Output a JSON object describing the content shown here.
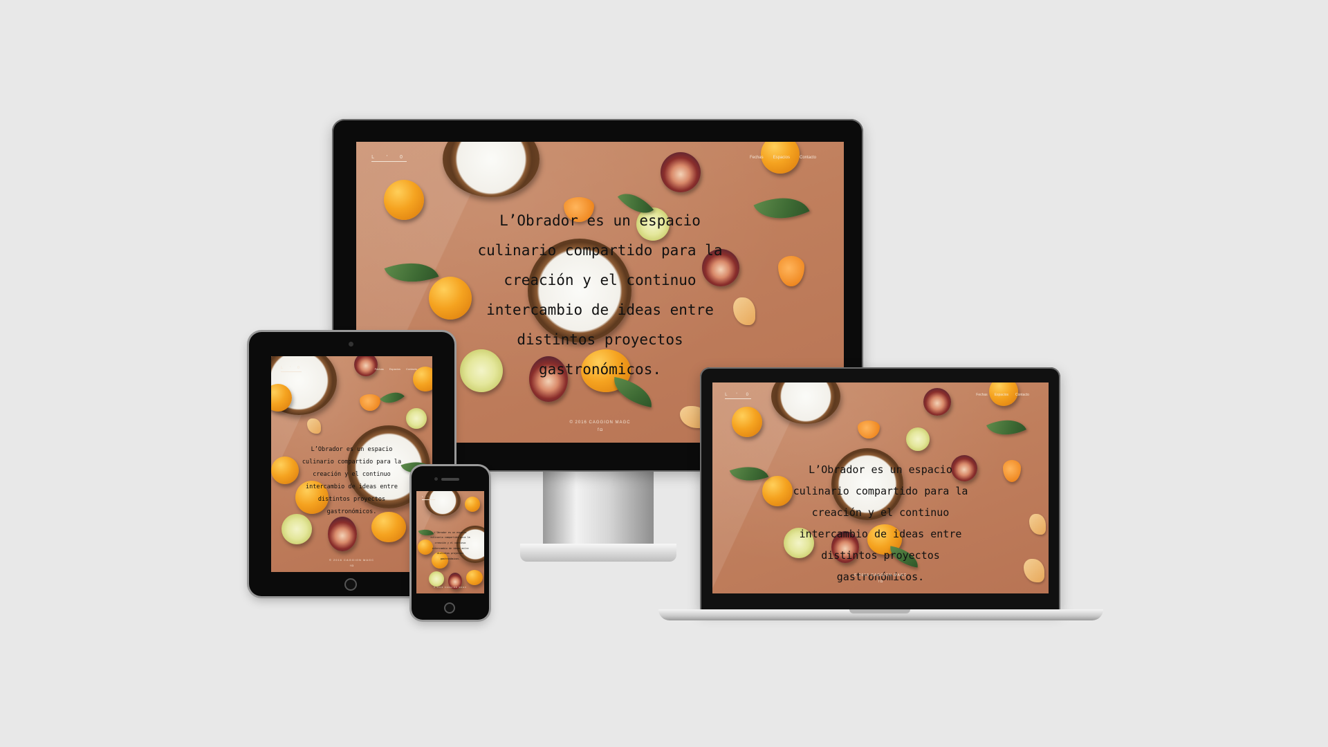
{
  "site": {
    "logo": "L ' O",
    "headline": "L’Obrador es un espacio culinario compartido para la creación y el continuo intercambio de ideas entre distintos proyectos gastronómicos.",
    "nav": [
      "Fechas",
      "Espacios",
      "Contacto"
    ],
    "footer": "© 2016 CAGGION MAGC",
    "social": [
      "f",
      "◘"
    ]
  },
  "headline_lines": [
    "L’Obrador es un espacio",
    "culinario compartido para la",
    "creación y el continuo",
    "intercambio de ideas entre",
    "distintos proyectos",
    "gastronómicos."
  ],
  "colors": {
    "page_bg": "#e8e8e8",
    "screen_bg": "#c07f5d",
    "bezel": "#0b0b0b",
    "text_dark": "#111111",
    "text_light": "#f3e6d8"
  },
  "devices": [
    "desktop-monitor",
    "laptop",
    "tablet",
    "phone"
  ],
  "icons": {
    "facebook": "facebook-icon",
    "instagram": "instagram-icon",
    "home_button": "home-button-icon",
    "camera": "camera-icon"
  }
}
